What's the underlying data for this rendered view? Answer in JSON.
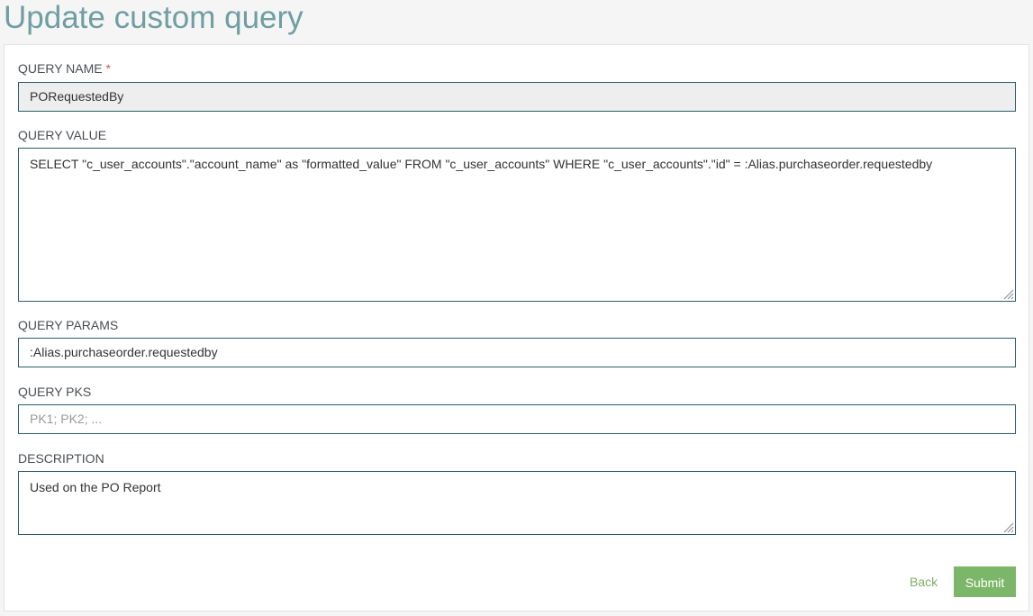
{
  "page": {
    "title": "Update custom query"
  },
  "form": {
    "query_name": {
      "label": "QUERY NAME",
      "required_mark": "*",
      "value": "PORequestedBy"
    },
    "query_value": {
      "label": "QUERY VALUE",
      "value": "SELECT \"c_user_accounts\".\"account_name\" as \"formatted_value\" FROM \"c_user_accounts\" WHERE \"c_user_accounts\".\"id\" = :Alias.purchaseorder.requestedby"
    },
    "query_params": {
      "label": "QUERY PARAMS",
      "value": ":Alias.purchaseorder.requestedby"
    },
    "query_pks": {
      "label": "QUERY PKS",
      "value": "",
      "placeholder": "PK1; PK2; ..."
    },
    "description": {
      "label": "DESCRIPTION",
      "value": "Used on the PO Report"
    }
  },
  "actions": {
    "back_label": "Back",
    "submit_label": "Submit"
  },
  "colors": {
    "title": "#6f9ea3",
    "input_border": "#2b5d6e",
    "submit_bg": "#7cb668",
    "back_link": "#7cb063",
    "required": "#d9534f"
  }
}
